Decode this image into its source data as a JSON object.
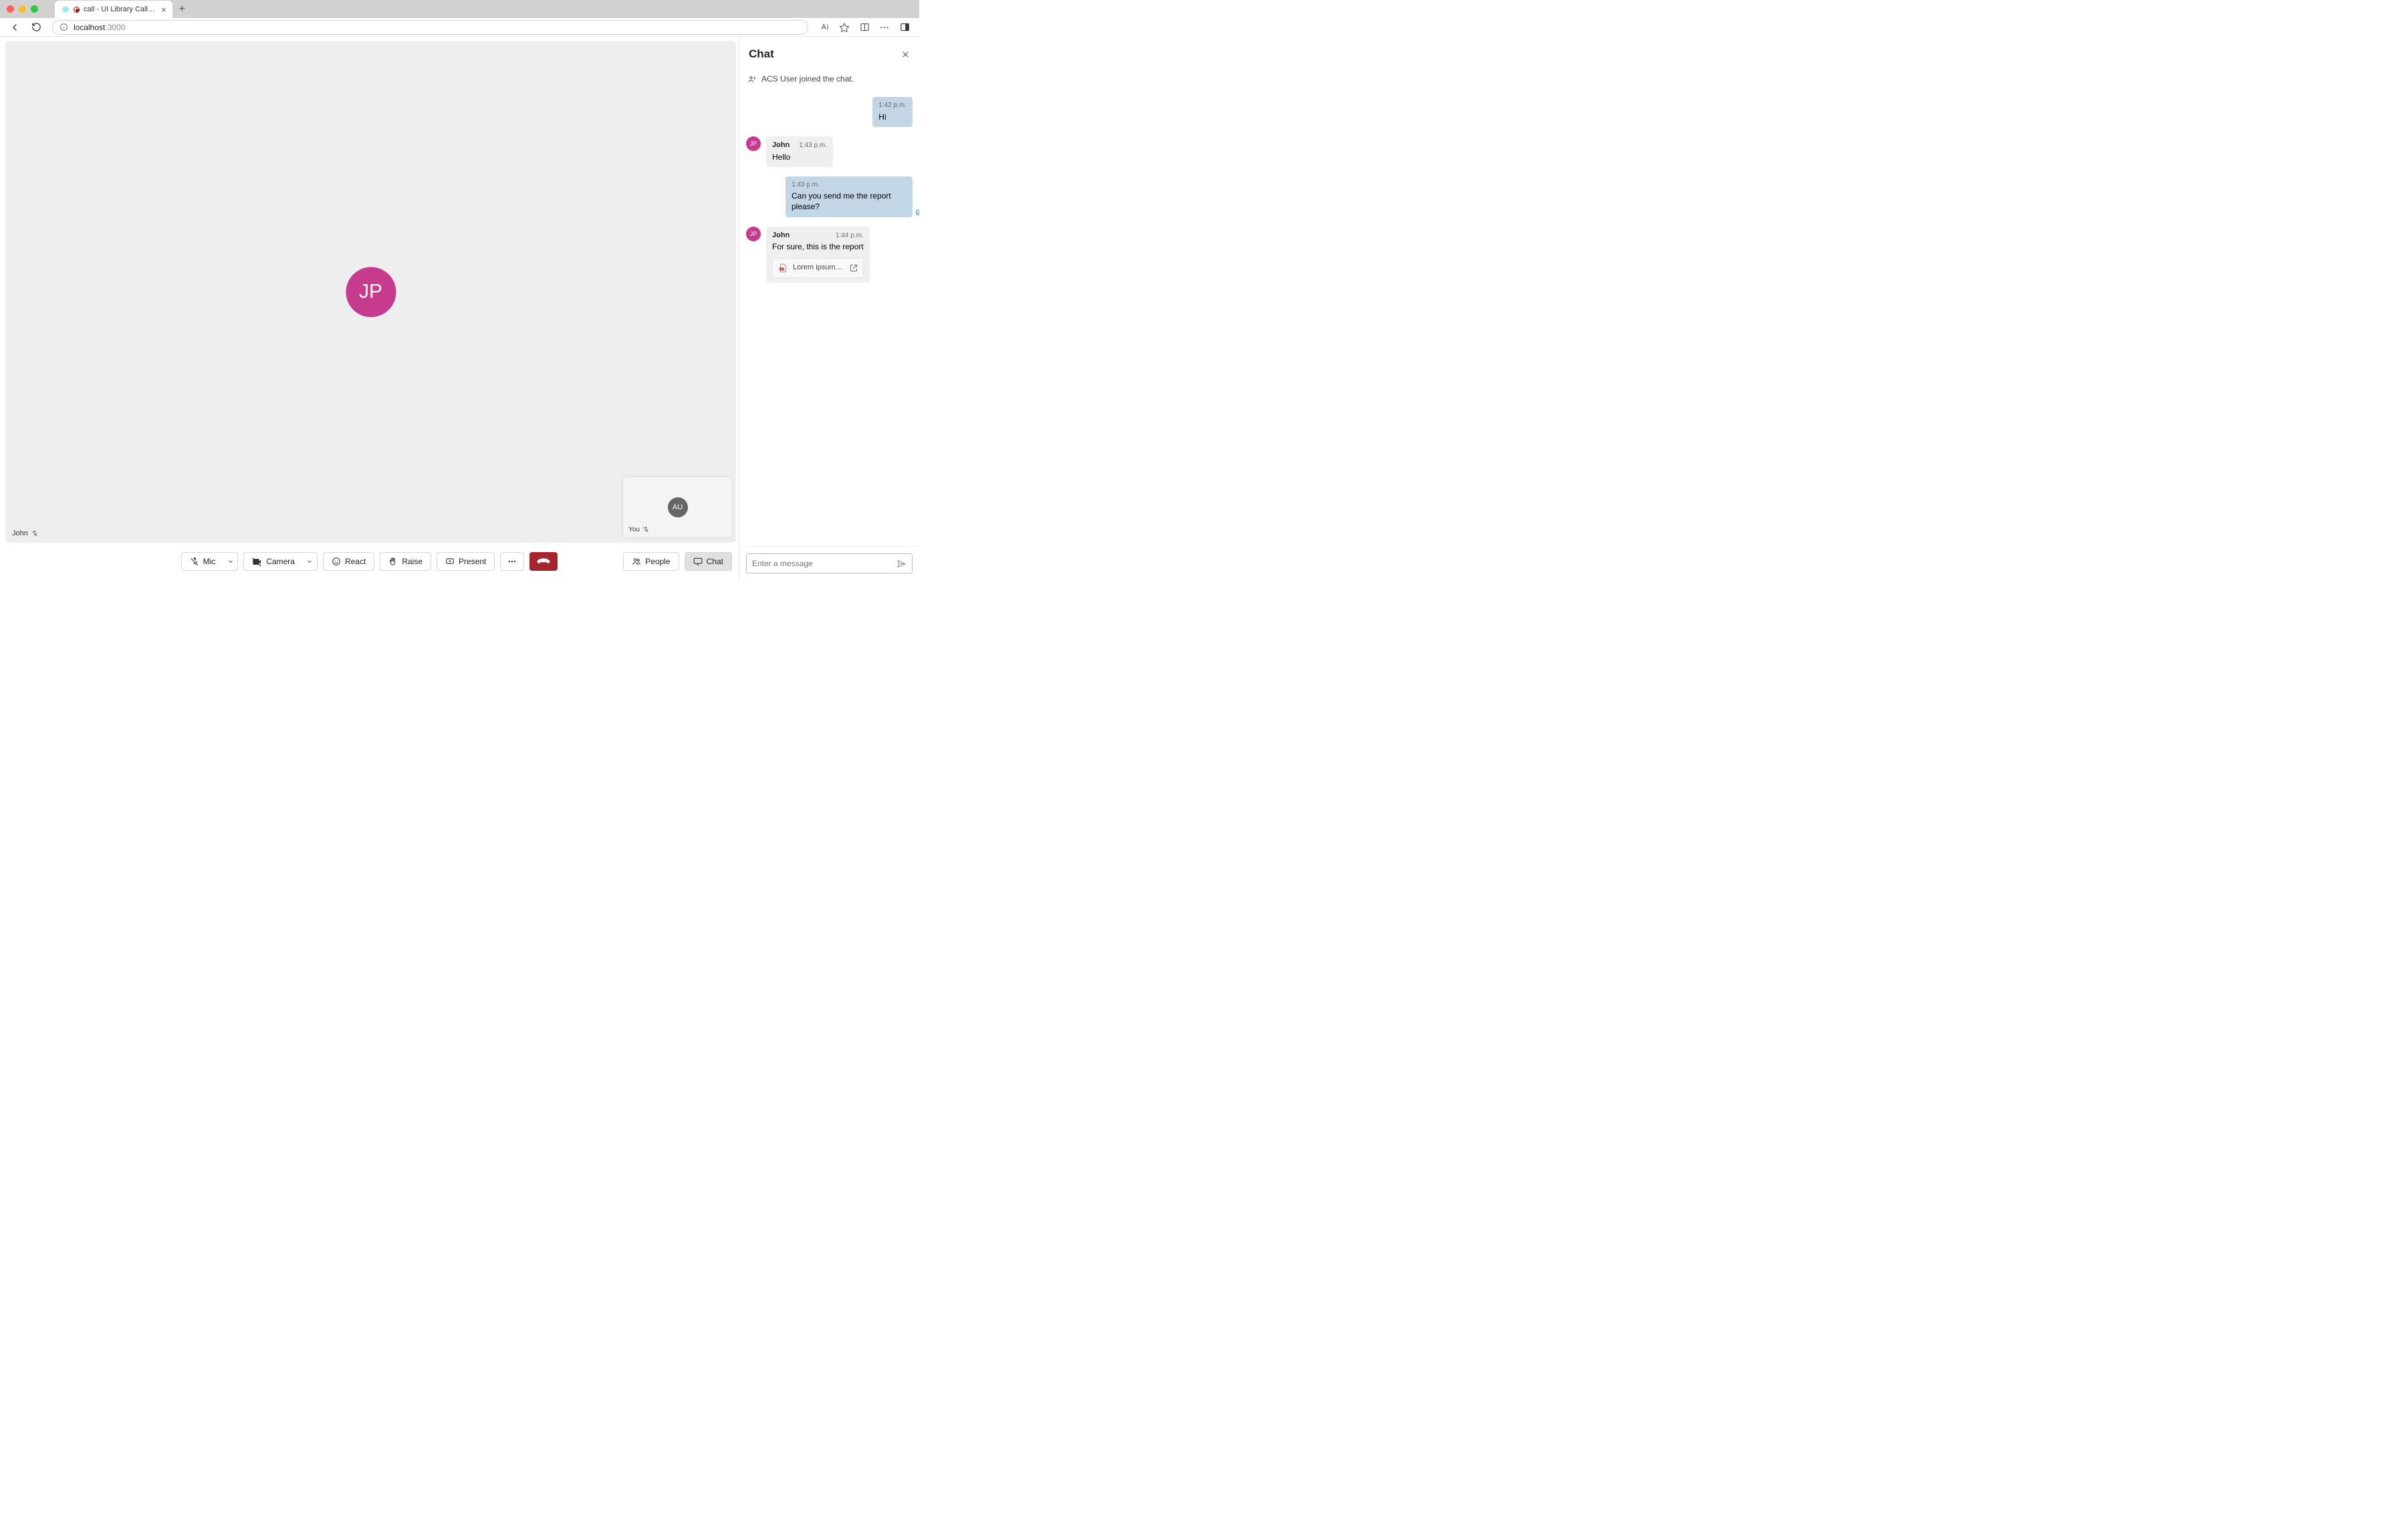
{
  "browser": {
    "tab_title": "call - UI Library Call With C",
    "url_host": "localhost",
    "url_port": ":3000"
  },
  "stage": {
    "remote_initials": "JP",
    "remote_name": "John",
    "self_initials": "AU",
    "self_label": "You"
  },
  "controls": {
    "mic": "Mic",
    "camera": "Camera",
    "react": "React",
    "raise": "Raise",
    "present": "Present",
    "people": "People",
    "chat": "Chat"
  },
  "chat": {
    "title": "Chat",
    "system_message": "ACS User joined the chat.",
    "messages": [
      {
        "from": "me",
        "time": "1:42 p.m.",
        "text": "Hi"
      },
      {
        "from": "them",
        "sender": "John",
        "initials": "JP",
        "time": "1:43 p.m.",
        "text": "Hello"
      },
      {
        "from": "me",
        "time": "1:43 p.m.",
        "text": "Can you send me the report please?",
        "receipt": true
      },
      {
        "from": "them",
        "sender": "John",
        "initials": "JP",
        "time": "1:44 p.m.",
        "text": "For sure, this is the report",
        "attachment": "Lorem ipsum…"
      }
    ],
    "input_placeholder": "Enter a message"
  }
}
